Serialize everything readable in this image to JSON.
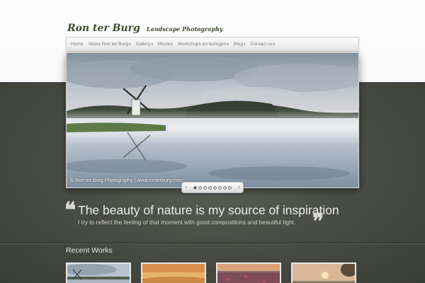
{
  "brand": {
    "name": "Ron ter Burg",
    "tagline": "Landscape Photography"
  },
  "nav": {
    "items": [
      {
        "label": "Home",
        "has_submenu": false
      },
      {
        "label": "About Ron ter Burg",
        "has_submenu": true
      },
      {
        "label": "Gallery",
        "has_submenu": true
      },
      {
        "label": "Movies",
        "has_submenu": false
      },
      {
        "label": "Workshops en lezingen",
        "has_submenu": true
      },
      {
        "label": "Blog",
        "has_submenu": true
      },
      {
        "label": "Contact us",
        "has_submenu": true
      }
    ],
    "submenu_indicator": "▾"
  },
  "slider": {
    "caption": "© Ron ter Burg Photography | www.ronterburg.com",
    "slide_count": 8,
    "active_slide": 1,
    "prev_icon": "chevron-left-icon",
    "next_icon": "chevron-right-icon",
    "prev_glyph": "‹",
    "next_glyph": "›"
  },
  "quote": {
    "headline": "The beauty of nature is my source of inspiration",
    "subline": "I try to reflect the feeling of that moment with good compositions and beautiful light.",
    "open_mark": "❝",
    "close_mark": "❞"
  },
  "recent_works": {
    "title": "Recent Works",
    "items": [
      {
        "name": "windmill-mist"
      },
      {
        "name": "sunset-fields"
      },
      {
        "name": "poppy-field"
      },
      {
        "name": "sunrise-tree"
      }
    ]
  },
  "colors": {
    "band": "#4a4e44",
    "brand_text": "#3e4a2c",
    "nav_text": "#7a7a7a"
  }
}
